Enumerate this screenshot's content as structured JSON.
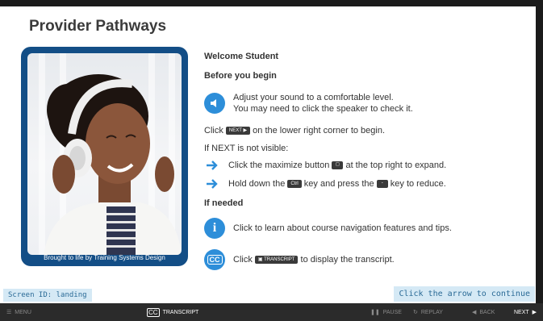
{
  "page": {
    "title": "Provider Pathways"
  },
  "photo": {
    "caption": "Brought to life by Training Systems Design"
  },
  "content": {
    "welcome": "Welcome Student",
    "before_heading": "Before you begin",
    "sound_line1": "Adjust your sound to a comfortable level.",
    "sound_line2": "You may need to click the speaker to check it.",
    "click_pre": "Click",
    "next_key": "NEXT",
    "click_post": "on the lower right corner to begin.",
    "if_next": "If NEXT is not visible:",
    "max_pre": "Click the maximize button",
    "max_post": "at the top right to expand.",
    "hold_pre": "Hold down the",
    "ctrl_key": "Ctrl",
    "hold_mid": "key and press the",
    "minus_key": "-",
    "hold_post": "key to reduce.",
    "if_needed": "If needed",
    "info_text": "Click to learn about course navigation features and tips.",
    "cc_pre": "Click",
    "cc_key": "TRANSCRIPT",
    "cc_post": "to display the transcript.",
    "info_glyph": "i",
    "cc_glyph": "CC"
  },
  "footer": {
    "screen_id": "Screen ID: landing",
    "continue_hint": "Click the arrow to continue"
  },
  "nav": {
    "menu": "MENU",
    "transcript": "TRANSCRIPT",
    "pause": "PAUSE",
    "replay": "REPLAY",
    "back": "BACK",
    "next": "NEXT"
  },
  "colors": {
    "accent": "#2d8ed9",
    "card": "#134e86",
    "bar": "#2b2b2b"
  },
  "icons": [
    "speaker-icon",
    "arrow-right-icon",
    "info-icon",
    "closed-caption-icon",
    "menu-icon",
    "pause-icon",
    "replay-icon",
    "back-icon",
    "next-icon"
  ]
}
